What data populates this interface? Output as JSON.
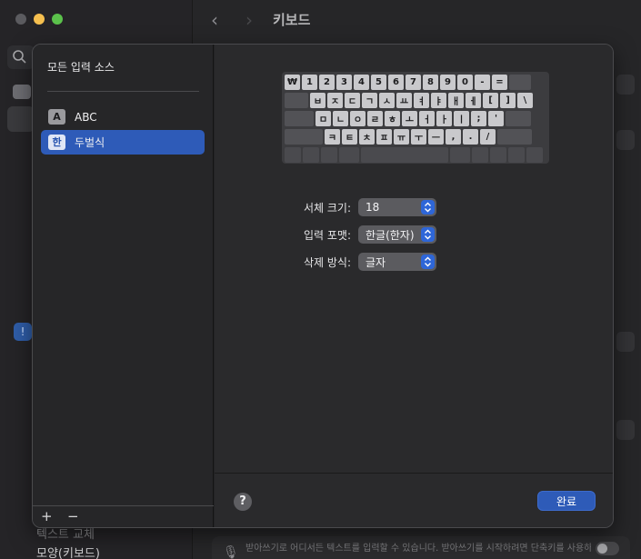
{
  "background_window": {
    "title": "키보드",
    "sidebar_partial_label_1": "텍스트 교체",
    "sidebar_partial_label_2": "모양(키보드)",
    "dictation_hint": "받아쓰기로 어디서든 텍스트를 입력할 수 있습니다. 받아쓰기를 시작하려면 단축키를 사용하거나"
  },
  "sheet": {
    "sidebar": {
      "heading": "모든 입력 소스",
      "items": [
        {
          "badge": "A",
          "label": "ABC",
          "selected": false
        },
        {
          "badge": "한",
          "label": "두벌식",
          "selected": true
        }
      ],
      "add_label": "+",
      "remove_label": "−"
    },
    "keyboard": {
      "rows": [
        [
          "₩",
          "1",
          "2",
          "3",
          "4",
          "5",
          "6",
          "7",
          "8",
          "9",
          "0",
          "-",
          "="
        ],
        [
          "ㅂ",
          "ㅈ",
          "ㄷ",
          "ㄱ",
          "ㅅ",
          "ㅛ",
          "ㅕ",
          "ㅑ",
          "ㅐ",
          "ㅔ",
          "[",
          "]",
          "\\"
        ],
        [
          "ㅁ",
          "ㄴ",
          "ㅇ",
          "ㄹ",
          "ㅎ",
          "ㅗ",
          "ㅓ",
          "ㅏ",
          "ㅣ",
          ";",
          "'"
        ],
        [
          "ㅋ",
          "ㅌ",
          "ㅊ",
          "ㅍ",
          "ㅠ",
          "ㅜ",
          "ㅡ",
          ",",
          ".",
          "/"
        ]
      ]
    },
    "form": {
      "font_size_label": "서체 크기:",
      "font_size_value": "18",
      "input_format_label": "입력 포맷:",
      "input_format_value": "한글(한자)",
      "delete_method_label": "삭제 방식:",
      "delete_method_value": "글자"
    },
    "help_label": "?",
    "done_label": "완료"
  },
  "colors": {
    "accent": "#2e5bb8",
    "popup_arrow": "#2e66d8"
  }
}
